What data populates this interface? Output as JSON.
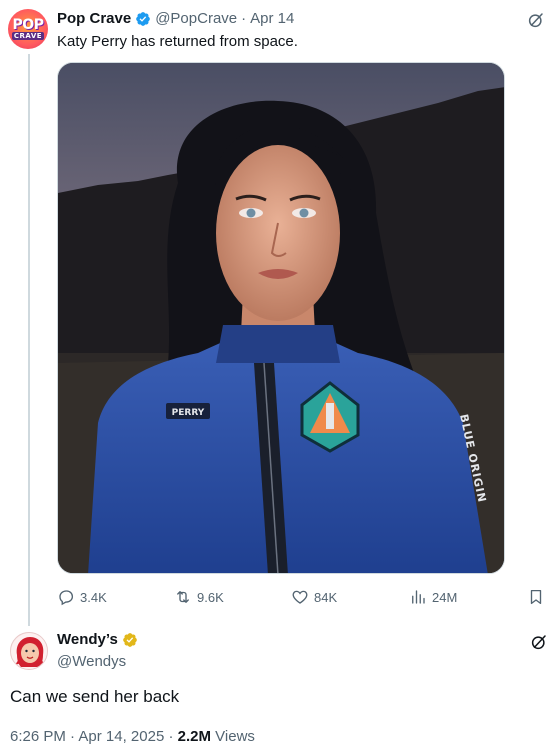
{
  "tweet1": {
    "name": "Pop Crave",
    "handle": "@PopCrave",
    "separator": "·",
    "date": "Apr 14",
    "text": "Katy Perry has returned from space.",
    "avatar_text_top": "POP",
    "avatar_text_bottom": "CRAVE",
    "media": {
      "suit_name_tag": "PERRY",
      "sleeve_text": "BLUE ORIGIN"
    },
    "stats": {
      "replies": "3.4K",
      "reposts": "9.6K",
      "likes": "84K",
      "views": "24M"
    }
  },
  "tweet2": {
    "name": "Wendy’s",
    "handle": "@Wendys",
    "text": "Can we send her back",
    "time": "6:26 PM",
    "date": "Apr 14, 2025",
    "views_count": "2.2M",
    "views_label": "Views"
  },
  "icons": [
    "verified-badge-icon",
    "grok-icon",
    "reply-icon",
    "repost-icon",
    "like-icon",
    "views-icon",
    "bookmark-icon",
    "gold-verified-badge-icon"
  ],
  "colors": {
    "text": "#0f1419",
    "secondary": "#536471",
    "verified_blue": "#1d9bf0",
    "verified_gold": "#e2b719",
    "thread_line": "#cfd9de"
  }
}
